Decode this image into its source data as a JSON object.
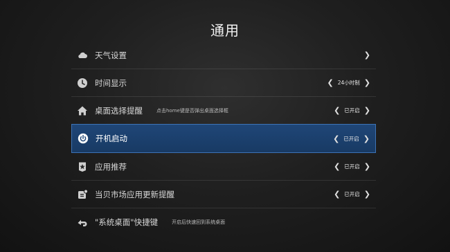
{
  "title": "通用",
  "items": [
    {
      "label": "天气设置",
      "icon": "cloud-icon",
      "value": "",
      "hint": ""
    },
    {
      "label": "时间显示",
      "icon": "clock-icon",
      "value": "24小时制",
      "hint": ""
    },
    {
      "label": "桌面选择提醒",
      "icon": "home-icon",
      "value": "已开启",
      "hint": "点击home键是否弹出桌面选择框"
    },
    {
      "label": "开机启动",
      "icon": "power-icon",
      "value": "已开启",
      "hint": "",
      "selected": true
    },
    {
      "label": "应用推荐",
      "icon": "star-badge-icon",
      "value": "已开启",
      "hint": ""
    },
    {
      "label": "当贝市场应用更新提醒",
      "icon": "update-notify-icon",
      "value": "已开启",
      "hint": ""
    },
    {
      "label": "\"系统桌面\"快捷键",
      "icon": "shortcut-icon",
      "value": "",
      "hint": "开启后快速回到系统桌面"
    }
  ],
  "arrows": {
    "left": "❮",
    "right": "❯"
  },
  "colors": {
    "selected_bg": "#1f4677",
    "selected_border": "#3d73b6",
    "background": "#1f1f1f"
  }
}
